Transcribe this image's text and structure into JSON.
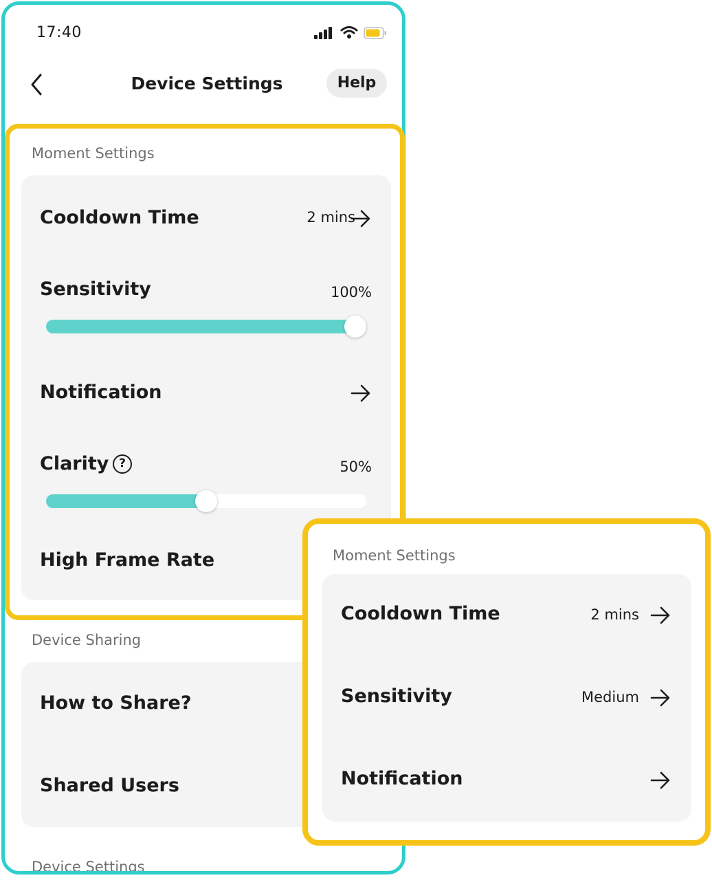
{
  "status_bar": {
    "time": "17:40"
  },
  "nav": {
    "title": "Device Settings",
    "help_label": "Help"
  },
  "moment_settings": {
    "label": "Moment Settings",
    "cooldown": {
      "title": "Cooldown Time",
      "value": "2 mins"
    },
    "sensitivity": {
      "title": "Sensitivity",
      "value": "100%",
      "level": 1.0
    },
    "notification": {
      "title": "Notification"
    },
    "clarity": {
      "title": "Clarity",
      "value": "50%",
      "level": 0.5
    },
    "high_frame_rate": {
      "title": "High Frame Rate"
    }
  },
  "device_sharing": {
    "label": "Device Sharing",
    "how_to_share": "How to Share?",
    "shared_users": "Shared Users"
  },
  "device_settings_section": {
    "label": "Device Settings"
  },
  "inset": {
    "label": "Moment Settings",
    "cooldown": {
      "title": "Cooldown Time",
      "value": "2 mins"
    },
    "sensitivity": {
      "title": "Sensitivity",
      "value": "Medium"
    },
    "notification": {
      "title": "Notification"
    }
  },
  "colors": {
    "accent": "#5fd3cb",
    "highlight": "#f6c418",
    "frame": "#2ecfcb"
  },
  "icons": [
    "signal-icon",
    "wifi-icon",
    "battery-icon",
    "back-chevron-icon",
    "arrow-right-icon",
    "help-circle-icon"
  ]
}
